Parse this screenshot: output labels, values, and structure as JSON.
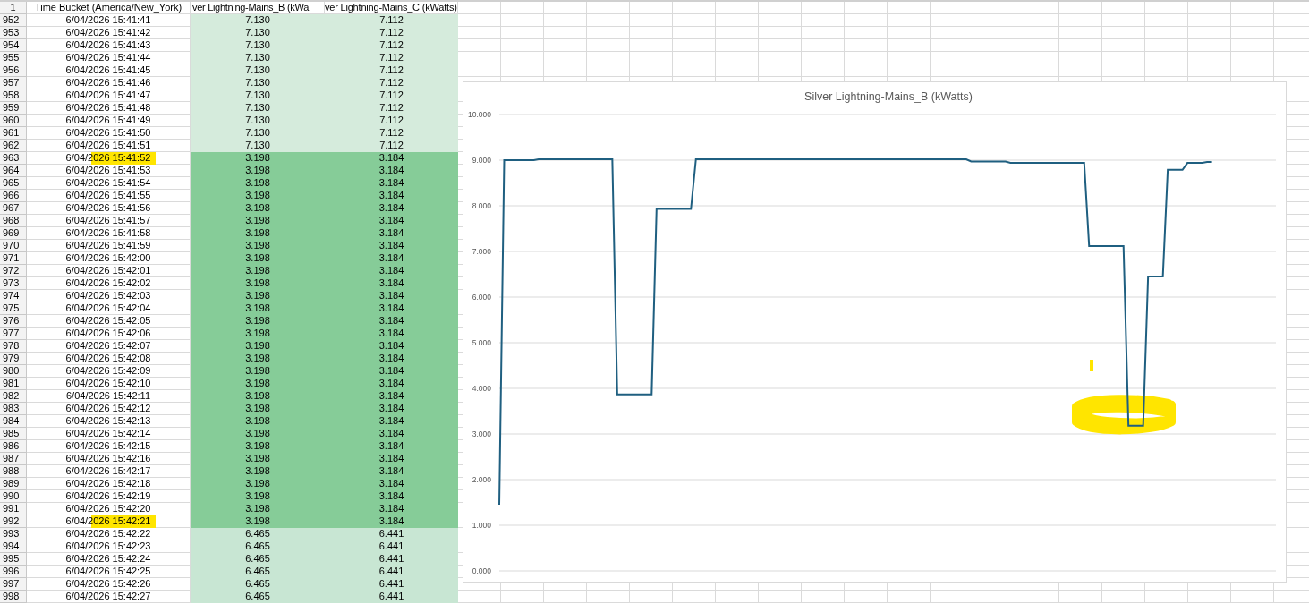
{
  "sheet": {
    "header_row": {
      "number": "1",
      "cells": [
        "Time Bucket (America/New_York)",
        "ver Lightning-Mains_B (kWa",
        "ver Lightning-Mains_C (kWatts)"
      ]
    },
    "rows": [
      {
        "number": "952",
        "time": "6/04/2026 15:41:41",
        "value_b": "7.130",
        "value_c": "7.112",
        "color": "#d5ebdc",
        "highlighted": false
      },
      {
        "number": "953",
        "time": "6/04/2026 15:41:42",
        "value_b": "7.130",
        "value_c": "7.112",
        "color": "#d5ebdc",
        "highlighted": false
      },
      {
        "number": "954",
        "time": "6/04/2026 15:41:43",
        "value_b": "7.130",
        "value_c": "7.112",
        "color": "#d5ebdc",
        "highlighted": false
      },
      {
        "number": "955",
        "time": "6/04/2026 15:41:44",
        "value_b": "7.130",
        "value_c": "7.112",
        "color": "#d5ebdc",
        "highlighted": false
      },
      {
        "number": "956",
        "time": "6/04/2026 15:41:45",
        "value_b": "7.130",
        "value_c": "7.112",
        "color": "#d5ebdc",
        "highlighted": false
      },
      {
        "number": "957",
        "time": "6/04/2026 15:41:46",
        "value_b": "7.130",
        "value_c": "7.112",
        "color": "#d5ebdc",
        "highlighted": false
      },
      {
        "number": "958",
        "time": "6/04/2026 15:41:47",
        "value_b": "7.130",
        "value_c": "7.112",
        "color": "#d5ebdc",
        "highlighted": false
      },
      {
        "number": "959",
        "time": "6/04/2026 15:41:48",
        "value_b": "7.130",
        "value_c": "7.112",
        "color": "#d5ebdc",
        "highlighted": false
      },
      {
        "number": "960",
        "time": "6/04/2026 15:41:49",
        "value_b": "7.130",
        "value_c": "7.112",
        "color": "#d5ebdc",
        "highlighted": false
      },
      {
        "number": "961",
        "time": "6/04/2026 15:41:50",
        "value_b": "7.130",
        "value_c": "7.112",
        "color": "#d5ebdc",
        "highlighted": false
      },
      {
        "number": "962",
        "time": "6/04/2026 15:41:51",
        "value_b": "7.130",
        "value_c": "7.112",
        "color": "#d5ebdc",
        "highlighted": false
      },
      {
        "number": "963",
        "time": "6/04/2026 15:41:52",
        "value_b": "3.198",
        "value_c": "3.184",
        "color": "#86cc98",
        "highlighted": true
      },
      {
        "number": "964",
        "time": "6/04/2026 15:41:53",
        "value_b": "3.198",
        "value_c": "3.184",
        "color": "#86cc98",
        "highlighted": false
      },
      {
        "number": "965",
        "time": "6/04/2026 15:41:54",
        "value_b": "3.198",
        "value_c": "3.184",
        "color": "#86cc98",
        "highlighted": false
      },
      {
        "number": "966",
        "time": "6/04/2026 15:41:55",
        "value_b": "3.198",
        "value_c": "3.184",
        "color": "#86cc98",
        "highlighted": false
      },
      {
        "number": "967",
        "time": "6/04/2026 15:41:56",
        "value_b": "3.198",
        "value_c": "3.184",
        "color": "#86cc98",
        "highlighted": false
      },
      {
        "number": "968",
        "time": "6/04/2026 15:41:57",
        "value_b": "3.198",
        "value_c": "3.184",
        "color": "#86cc98",
        "highlighted": false
      },
      {
        "number": "969",
        "time": "6/04/2026 15:41:58",
        "value_b": "3.198",
        "value_c": "3.184",
        "color": "#86cc98",
        "highlighted": false
      },
      {
        "number": "970",
        "time": "6/04/2026 15:41:59",
        "value_b": "3.198",
        "value_c": "3.184",
        "color": "#86cc98",
        "highlighted": false
      },
      {
        "number": "971",
        "time": "6/04/2026 15:42:00",
        "value_b": "3.198",
        "value_c": "3.184",
        "color": "#86cc98",
        "highlighted": false
      },
      {
        "number": "972",
        "time": "6/04/2026 15:42:01",
        "value_b": "3.198",
        "value_c": "3.184",
        "color": "#86cc98",
        "highlighted": false
      },
      {
        "number": "973",
        "time": "6/04/2026 15:42:02",
        "value_b": "3.198",
        "value_c": "3.184",
        "color": "#86cc98",
        "highlighted": false
      },
      {
        "number": "974",
        "time": "6/04/2026 15:42:03",
        "value_b": "3.198",
        "value_c": "3.184",
        "color": "#86cc98",
        "highlighted": false
      },
      {
        "number": "975",
        "time": "6/04/2026 15:42:04",
        "value_b": "3.198",
        "value_c": "3.184",
        "color": "#86cc98",
        "highlighted": false
      },
      {
        "number": "976",
        "time": "6/04/2026 15:42:05",
        "value_b": "3.198",
        "value_c": "3.184",
        "color": "#86cc98",
        "highlighted": false
      },
      {
        "number": "977",
        "time": "6/04/2026 15:42:06",
        "value_b": "3.198",
        "value_c": "3.184",
        "color": "#86cc98",
        "highlighted": false
      },
      {
        "number": "978",
        "time": "6/04/2026 15:42:07",
        "value_b": "3.198",
        "value_c": "3.184",
        "color": "#86cc98",
        "highlighted": false
      },
      {
        "number": "979",
        "time": "6/04/2026 15:42:08",
        "value_b": "3.198",
        "value_c": "3.184",
        "color": "#86cc98",
        "highlighted": false
      },
      {
        "number": "980",
        "time": "6/04/2026 15:42:09",
        "value_b": "3.198",
        "value_c": "3.184",
        "color": "#86cc98",
        "highlighted": false
      },
      {
        "number": "981",
        "time": "6/04/2026 15:42:10",
        "value_b": "3.198",
        "value_c": "3.184",
        "color": "#86cc98",
        "highlighted": false
      },
      {
        "number": "982",
        "time": "6/04/2026 15:42:11",
        "value_b": "3.198",
        "value_c": "3.184",
        "color": "#86cc98",
        "highlighted": false
      },
      {
        "number": "983",
        "time": "6/04/2026 15:42:12",
        "value_b": "3.198",
        "value_c": "3.184",
        "color": "#86cc98",
        "highlighted": false
      },
      {
        "number": "984",
        "time": "6/04/2026 15:42:13",
        "value_b": "3.198",
        "value_c": "3.184",
        "color": "#86cc98",
        "highlighted": false
      },
      {
        "number": "985",
        "time": "6/04/2026 15:42:14",
        "value_b": "3.198",
        "value_c": "3.184",
        "color": "#86cc98",
        "highlighted": false
      },
      {
        "number": "986",
        "time": "6/04/2026 15:42:15",
        "value_b": "3.198",
        "value_c": "3.184",
        "color": "#86cc98",
        "highlighted": false
      },
      {
        "number": "987",
        "time": "6/04/2026 15:42:16",
        "value_b": "3.198",
        "value_c": "3.184",
        "color": "#86cc98",
        "highlighted": false
      },
      {
        "number": "988",
        "time": "6/04/2026 15:42:17",
        "value_b": "3.198",
        "value_c": "3.184",
        "color": "#86cc98",
        "highlighted": false
      },
      {
        "number": "989",
        "time": "6/04/2026 15:42:18",
        "value_b": "3.198",
        "value_c": "3.184",
        "color": "#86cc98",
        "highlighted": false
      },
      {
        "number": "990",
        "time": "6/04/2026 15:42:19",
        "value_b": "3.198",
        "value_c": "3.184",
        "color": "#86cc98",
        "highlighted": false
      },
      {
        "number": "991",
        "time": "6/04/2026 15:42:20",
        "value_b": "3.198",
        "value_c": "3.184",
        "color": "#86cc98",
        "highlighted": false
      },
      {
        "number": "992",
        "time": "6/04/2026 15:42:21",
        "value_b": "3.198",
        "value_c": "3.184",
        "color": "#86cc98",
        "highlighted": true
      },
      {
        "number": "993",
        "time": "6/04/2026 15:42:22",
        "value_b": "6.465",
        "value_c": "6.441",
        "color": "#c8e6d3",
        "highlighted": false
      },
      {
        "number": "994",
        "time": "6/04/2026 15:42:23",
        "value_b": "6.465",
        "value_c": "6.441",
        "color": "#c8e6d3",
        "highlighted": false
      },
      {
        "number": "995",
        "time": "6/04/2026 15:42:24",
        "value_b": "6.465",
        "value_c": "6.441",
        "color": "#c8e6d3",
        "highlighted": false
      },
      {
        "number": "996",
        "time": "6/04/2026 15:42:25",
        "value_b": "6.465",
        "value_c": "6.441",
        "color": "#c8e6d3",
        "highlighted": false
      },
      {
        "number": "997",
        "time": "6/04/2026 15:42:26",
        "value_b": "6.465",
        "value_c": "6.441",
        "color": "#c8e6d3",
        "highlighted": false
      },
      {
        "number": "998",
        "time": "6/04/2026 15:42:27",
        "value_b": "6.465",
        "value_c": "6.441",
        "color": "#c8e6d3",
        "highlighted": false
      }
    ]
  },
  "chart": {
    "scribble": true,
    "chart_data": {
      "type": "line",
      "title": "Silver Lightning-Mains_B (kWatts)",
      "categories": [
        null,
        null,
        null,
        null,
        null,
        null,
        null,
        null,
        null,
        null,
        null,
        null,
        null,
        null,
        null,
        null,
        null,
        null,
        null,
        null,
        null,
        null,
        null,
        null,
        null,
        null,
        null,
        null,
        null,
        null,
        null,
        null,
        null,
        null,
        null,
        null,
        null,
        null,
        null,
        null,
        null,
        null,
        null,
        null,
        null,
        null,
        null,
        null,
        null,
        null,
        null,
        null,
        null,
        null,
        null,
        null,
        null,
        null,
        null,
        null,
        null,
        null,
        null,
        null,
        null,
        null,
        null,
        null,
        null,
        null,
        null,
        null,
        null,
        null,
        null,
        null,
        null,
        null,
        null,
        null,
        null,
        null,
        null,
        null,
        null,
        null,
        null,
        null,
        null,
        null,
        null,
        null,
        null,
        null,
        null,
        null,
        null,
        null,
        null,
        null,
        null,
        null,
        null,
        null,
        null,
        null,
        null,
        null,
        null,
        null,
        null,
        null,
        null,
        null,
        null,
        null,
        null,
        null,
        null,
        null,
        null,
        null,
        null,
        null,
        null,
        null,
        null,
        null,
        null,
        null,
        null,
        null,
        null,
        null,
        null,
        null,
        null,
        null,
        null,
        null,
        null,
        null,
        null,
        null,
        null,
        null
      ],
      "values": [
        1.45,
        9.0,
        9.0,
        9.0,
        9.0,
        9.0,
        9.0,
        9.0,
        9.02,
        9.02,
        9.02,
        9.02,
        9.02,
        9.02,
        9.02,
        9.02,
        9.02,
        9.02,
        9.02,
        9.02,
        9.02,
        9.02,
        9.02,
        9.02,
        3.87,
        3.87,
        3.87,
        3.87,
        3.87,
        3.87,
        3.87,
        3.87,
        7.93,
        7.93,
        7.93,
        7.93,
        7.93,
        7.93,
        7.93,
        7.93,
        9.02,
        9.02,
        9.02,
        9.02,
        9.02,
        9.02,
        9.02,
        9.02,
        9.02,
        9.02,
        9.02,
        9.02,
        9.02,
        9.02,
        9.02,
        9.02,
        9.02,
        9.02,
        9.02,
        9.02,
        9.02,
        9.02,
        9.02,
        9.02,
        9.02,
        9.02,
        9.02,
        9.02,
        9.02,
        9.02,
        9.02,
        9.02,
        9.02,
        9.02,
        9.02,
        9.02,
        9.02,
        9.02,
        9.02,
        9.02,
        9.02,
        9.02,
        9.02,
        9.02,
        9.02,
        9.02,
        9.02,
        9.02,
        9.02,
        9.02,
        9.02,
        9.02,
        9.02,
        9.02,
        9.02,
        9.02,
        8.97,
        8.97,
        8.97,
        8.97,
        8.97,
        8.97,
        8.97,
        8.97,
        8.94,
        8.94,
        8.94,
        8.94,
        8.94,
        8.94,
        8.94,
        8.94,
        8.94,
        8.94,
        8.94,
        8.94,
        8.94,
        8.94,
        8.94,
        8.94,
        7.12,
        7.12,
        7.12,
        7.12,
        7.12,
        7.12,
        7.12,
        7.12,
        3.18,
        3.18,
        3.18,
        3.18,
        6.45,
        6.45,
        6.45,
        6.45,
        8.79,
        8.79,
        8.79,
        8.79,
        8.94,
        8.94,
        8.94,
        8.94,
        8.96,
        8.96
      ],
      "ylim": [
        0,
        10
      ],
      "grid": true,
      "yticks": [
        {
          "value": 0,
          "label": "0.000"
        },
        {
          "value": 1,
          "label": "1.000"
        },
        {
          "value": 2,
          "label": "2.000"
        },
        {
          "value": 3,
          "label": "3.000"
        },
        {
          "value": 4,
          "label": "4.000"
        },
        {
          "value": 5,
          "label": "5.000"
        },
        {
          "value": 6,
          "label": "6.000"
        },
        {
          "value": 7,
          "label": "7.000"
        },
        {
          "value": 8,
          "label": "8.000"
        },
        {
          "value": 9,
          "label": "9.000"
        },
        {
          "value": 10,
          "label": "10.000"
        }
      ]
    }
  }
}
